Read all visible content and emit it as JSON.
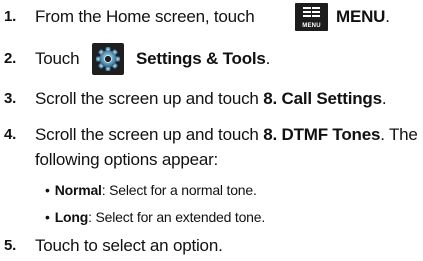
{
  "steps": [
    {
      "num": "1.",
      "pre": "From the Home screen, touch",
      "bold": "MENU",
      "post": "."
    },
    {
      "num": "2.",
      "pre": "Touch",
      "bold": "Settings & Tools",
      "post": "."
    },
    {
      "num": "3.",
      "pre": "Scroll the screen up and touch",
      "bold": "8. Call Settings",
      "post": "."
    },
    {
      "num": "4.",
      "pre": "Scroll the screen up and touch",
      "bold": "8. DTMF Tones",
      "post": ". The",
      "line2": "following options appear:"
    },
    {
      "num": "5.",
      "text": "Touch to select an option."
    }
  ],
  "bullets": [
    {
      "term": "Normal",
      "desc": ": Select for a normal tone."
    },
    {
      "term": "Long",
      "desc": ": Select for an extended tone."
    }
  ],
  "icons": {
    "menu_icon_label": "MENU",
    "menu_icon": "menu-grid-icon",
    "settings_icon": "gear-icon"
  }
}
